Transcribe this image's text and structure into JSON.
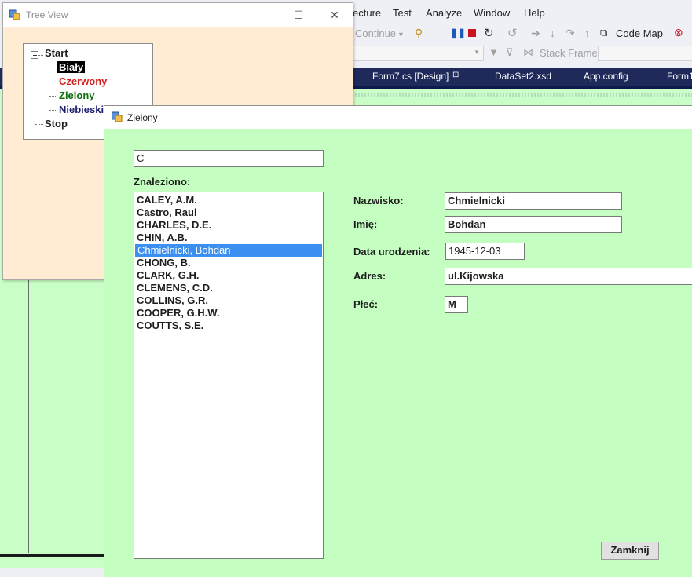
{
  "vs": {
    "menu": [
      "ecture",
      "Test",
      "Analyze",
      "Window",
      "Help"
    ],
    "toolbar": {
      "continue_label": "Continue",
      "codemap_label": "Code Map"
    },
    "stack_frame_label": "Stack Frame:",
    "tabs": [
      "Form7.cs [Design]",
      "DataSet2.xsd",
      "App.config",
      "Form1"
    ]
  },
  "tree_window": {
    "title": "Tree View",
    "nodes": {
      "root": "Start",
      "children": [
        "Biały",
        "Czerwony",
        "Zielony",
        "Niebieski"
      ],
      "last": "Stop"
    },
    "colors": {
      "bialy_bg": "#000000",
      "czerwony": "#d21f1f",
      "zielony": "#0b6e0b",
      "niebieski": "#1c1f6e"
    }
  },
  "z_window": {
    "title": "Zielony",
    "search_value": "C",
    "found_label": "Znaleziono:",
    "results": [
      "CALEY, A.M.",
      "Castro, Raul",
      "CHARLES, D.E.",
      "CHIN, A.B.",
      "Chmielnicki, Bohdan",
      "CHONG, B.",
      "CLARK, G.H.",
      "CLEMENS, C.D.",
      "COLLINS, G.R.",
      "COOPER, G.H.W.",
      "COUTTS, S.E."
    ],
    "selected_index": 4,
    "fields": {
      "surname_label": "Nazwisko:",
      "surname_value": "Chmielnicki",
      "firstname_label": "Imię:",
      "firstname_value": "Bohdan",
      "birthdate_label": "Data urodzenia:",
      "birthdate_value": "1945-12-03",
      "address_label": "Adres:",
      "address_value": "ul.Kijowska",
      "sex_label": "Płeć:",
      "sex_value": "M"
    },
    "close_label": "Zamknij"
  }
}
